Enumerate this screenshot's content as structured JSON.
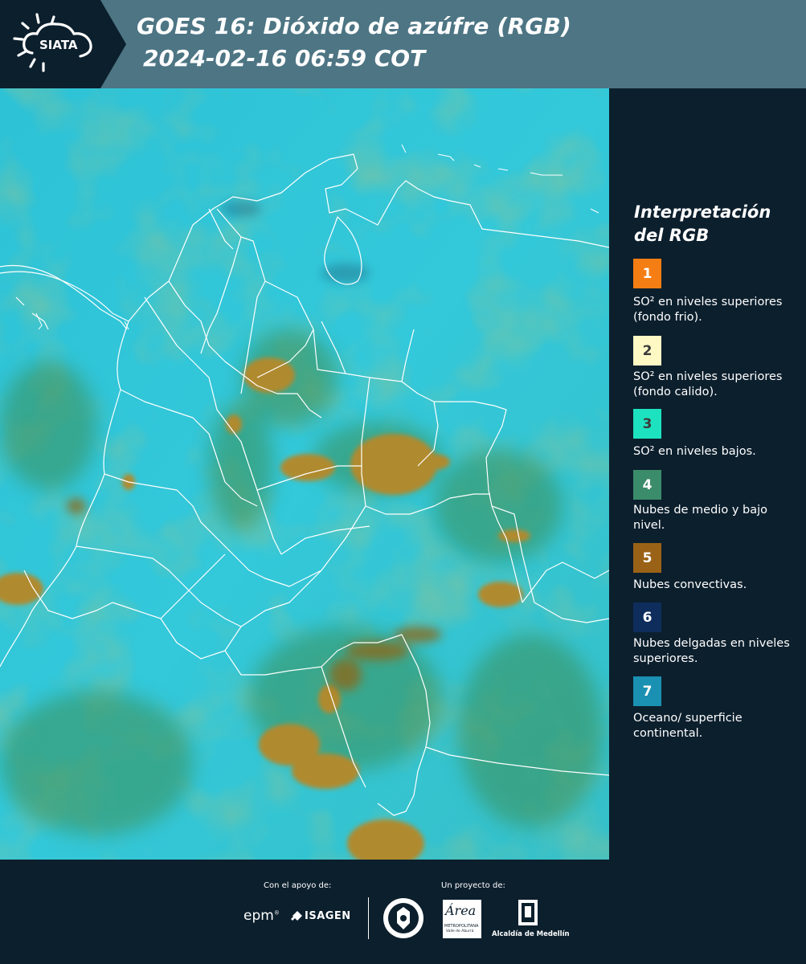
{
  "header": {
    "logo_text": "SIATA",
    "title_line1": "GOES 16: Dióxido de azúfre (RGB)",
    "title_line2": "2024-02-16 06:59 COT"
  },
  "legend": {
    "title_line1": "Interpretación",
    "title_line2": "del RGB",
    "items": [
      {
        "number": "1",
        "color": "#f57e14",
        "text_color": "#ffffff",
        "label": "SO² en niveles superiores (fondo frio)."
      },
      {
        "number": "2",
        "color": "#fdf8c4",
        "text_color": "#3a3a3a",
        "label": "SO² en niveles superiores (fondo calido)."
      },
      {
        "number": "3",
        "color": "#1de2c0",
        "text_color": "#3a3a3a",
        "label": "SO² en niveles bajos."
      },
      {
        "number": "4",
        "color": "#3b8c6a",
        "text_color": "#ffffff",
        "label": "Nubes de medio y bajo nivel."
      },
      {
        "number": "5",
        "color": "#9a6216",
        "text_color": "#ffffff",
        "label": "Nubes convectivas."
      },
      {
        "number": "6",
        "color": "#0e2d5d",
        "text_color": "#ffffff",
        "label": "Nubes delgadas en niveles superiores."
      },
      {
        "number": "7",
        "color": "#1a90b2",
        "text_color": "#ffffff",
        "label": "Oceano/ superficie continental."
      }
    ]
  },
  "footer": {
    "support_label": "Con el apoyo de:",
    "project_label": "Un proyecto de:",
    "epm_logo_text": "epm",
    "isagen_logo_text": "ISAGEN",
    "area_logo_text": "Área",
    "area_logo_subtext": "METROPOLITANA",
    "area_logo_subtext2": "Valle de Aburrá",
    "alcaldia_logo_text": "Alcaldía de Medellín"
  },
  "colors": {
    "header_bg": "#4d7584",
    "panel_bg": "#0c1f2d",
    "ocean_cyan": "#2fc3d8",
    "low_cloud_green": "#3f8f56",
    "convective_brown": "#b48a2c"
  }
}
